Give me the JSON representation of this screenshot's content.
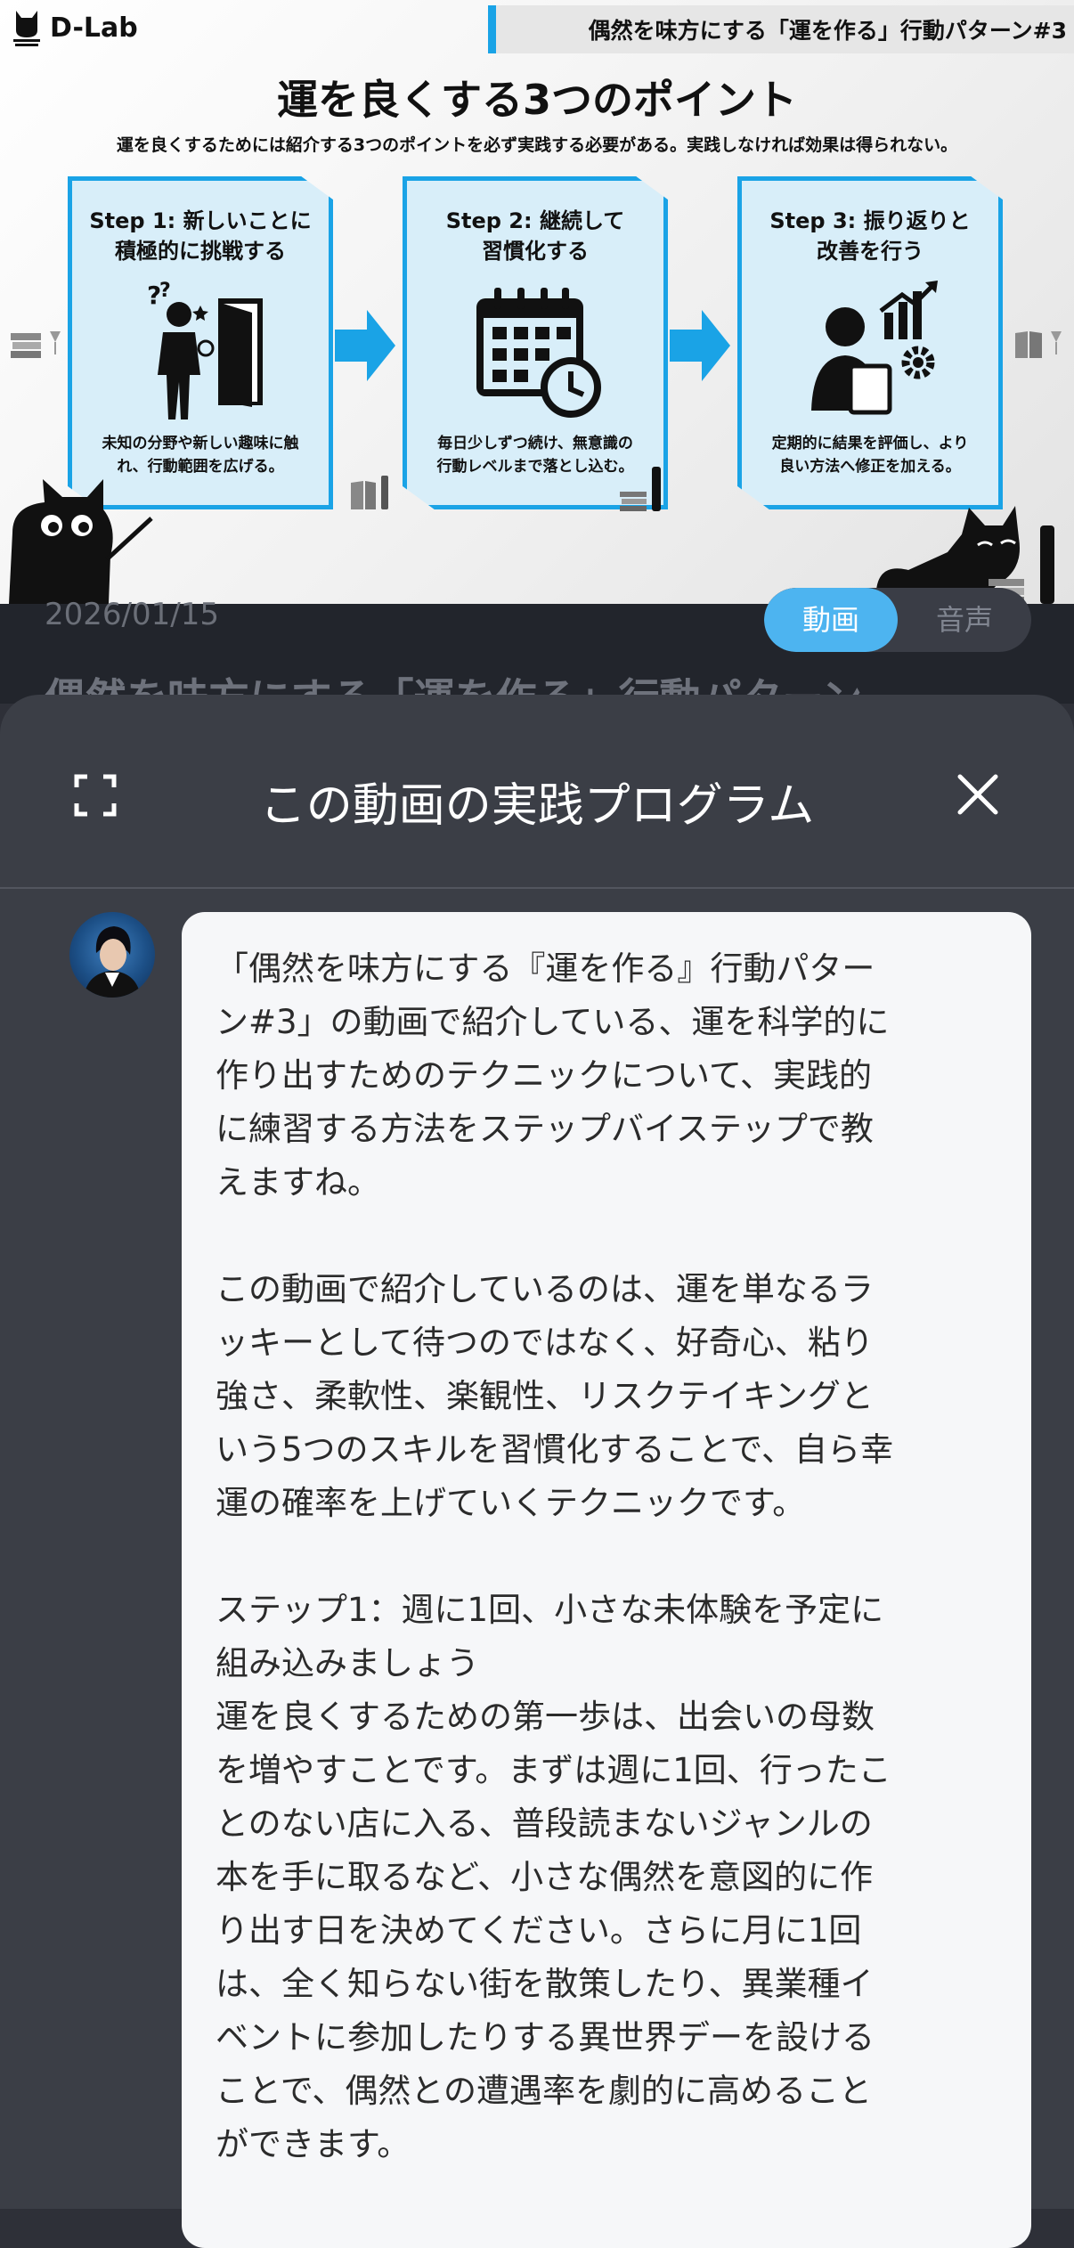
{
  "thumbnail": {
    "logo_text": "D-Lab",
    "banner_text": "偶然を味方にする「運を作る」行動パターン#3",
    "title": "運を良くする3つのポイント",
    "subtitle": "運を良くするためには紹介する3つのポイントを必ず実践する必要がある。実践しなければ効果は得られない。",
    "steps": [
      {
        "title": "Step 1: 新しいことに\n積極的に挑戦する",
        "desc": "未知の分野や新しい趣味に触\nれ、行動範囲を広げる。",
        "icon": "explorer-door-icon"
      },
      {
        "title": "Step 2: 継続して\n習慣化する",
        "desc": "毎日少しずつ続け、無意識の\n行動レベルまで落とし込む。",
        "icon": "calendar-clock-icon"
      },
      {
        "title": "Step 3: 振り返りと\n改善を行う",
        "desc": "定期的に結果を評価し、より\n良い方法へ修正を加える。",
        "icon": "review-chart-icon"
      }
    ],
    "accent_color": "#1aa3e6"
  },
  "video": {
    "date": "2026/01/15",
    "title": "偶然を味方にする「運を作る」行動パターン",
    "toggle": {
      "active": "動画",
      "inactive": "音声"
    }
  },
  "sheet": {
    "title": "この動画の実践プログラム",
    "expand_icon": "expand-icon",
    "close_icon": "close-icon",
    "message": "「偶然を味方にする『運を作る』行動パター\nン#3」の動画で紹介している、運を科学的に\n作り出すためのテクニックについて、実践的\nに練習する方法をステップバイステップで教\nえますね。\n\nこの動画で紹介しているのは、運を単なるラ\nッキーとして待つのではなく、好奇心、粘り\n強さ、柔軟性、楽観性、リスクテイキングと\nいう5つのスキルを習慣化することで、自ら幸\n運の確率を上げていくテクニックです。\n\nステップ1：週に1回、小さな未体験を予定に\n組み込みましょう\n運を良くするための第一歩は、出会いの母数\nを増やすことです。まずは週に1回、行ったこ\nとのない店に入る、普段読まないジャンルの\n本を手に取るなど、小さな偶然を意図的に作\nり出す日を決めてください。さらに月に1回\nは、全く知らない街を散策したり、異業種イ\nベントに参加したりする異世界デーを設ける\nことで、偶然との遭遇率を劇的に高めること\nができます。"
  },
  "colors": {
    "background": "#2e3038",
    "sheet": "#3b3e46",
    "bubble": "#f6f7f9",
    "toggle_active": "#4db4f0"
  }
}
